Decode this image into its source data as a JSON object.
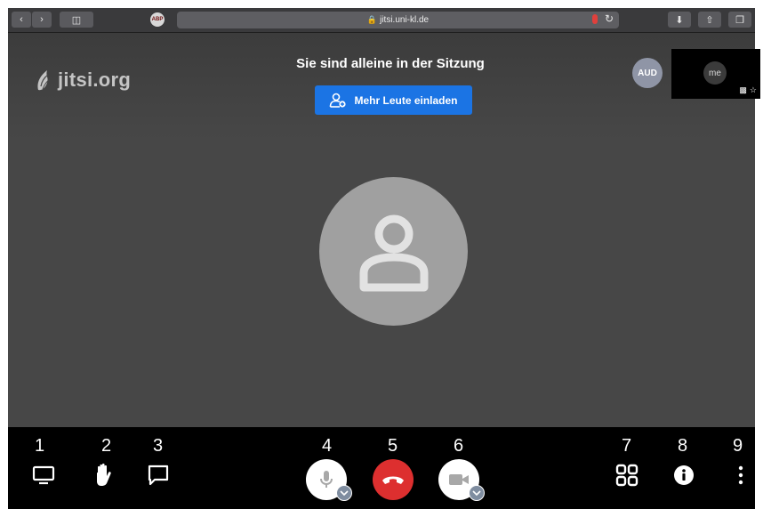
{
  "browser": {
    "url": "jitsi.uni-kl.de",
    "abp_label": "ABP"
  },
  "meeting": {
    "watermark": "jitsi.org",
    "notice": "Sie sind alleine in der Sitzung",
    "invite_label": "Mehr Leute einladen",
    "remote_avatar": "AUD",
    "self_label": "me"
  },
  "toolbar": {
    "numbers": [
      "1",
      "2",
      "3",
      "4",
      "5",
      "6",
      "7",
      "8",
      "9"
    ],
    "colors": {
      "hangup": "#dd2f2f",
      "invite": "#1b74e4"
    },
    "icons": [
      "screen-share-icon",
      "raise-hand-icon",
      "chat-icon",
      "microphone-icon",
      "hangup-icon",
      "camera-icon",
      "tile-view-icon",
      "info-icon",
      "more-icon"
    ]
  }
}
